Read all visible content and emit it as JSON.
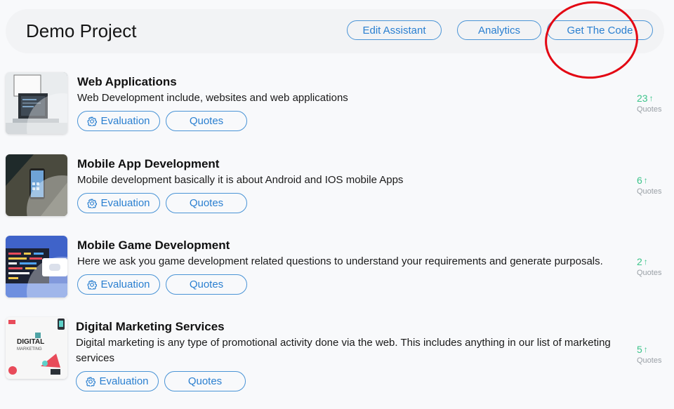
{
  "header": {
    "title": "Demo Project",
    "buttons": {
      "edit_assistant": "Edit Assistant",
      "analytics": "Analytics",
      "get_the_code": "Get The Code"
    }
  },
  "annotation": {
    "color": "#e30613",
    "target": "Get The Code"
  },
  "items": [
    {
      "title": "Web Applications",
      "description": "Web Development include, websites and web applications",
      "evaluation_label": "Evaluation",
      "quotes_label": "Quotes",
      "count": "23",
      "count_label": "Quotes",
      "trend": "up"
    },
    {
      "title": "Mobile App Development",
      "description": "Mobile development basically it is about Android and IOS mobile Apps",
      "evaluation_label": "Evaluation",
      "quotes_label": "Quotes",
      "count": "6",
      "count_label": "Quotes",
      "trend": "up"
    },
    {
      "title": "Mobile Game Development",
      "description": "Here we ask you game development related questions to understand your requirements and generate purposals.",
      "evaluation_label": "Evaluation",
      "quotes_label": "Quotes",
      "count": "2",
      "count_label": "Quotes",
      "trend": "up"
    },
    {
      "title": "Digital Marketing Services",
      "description": "Digital marketing is any type of promotional activity done via the web. This includes anything in our list of marketing services",
      "evaluation_label": "Evaluation",
      "quotes_label": "Quotes",
      "count": "5",
      "count_label": "Quotes",
      "trend": "up"
    }
  ],
  "colors": {
    "accent": "#2a7fd0",
    "trend_up": "#3cc48a",
    "muted": "#9aa0a6"
  },
  "icons": {
    "trend": "↑"
  }
}
